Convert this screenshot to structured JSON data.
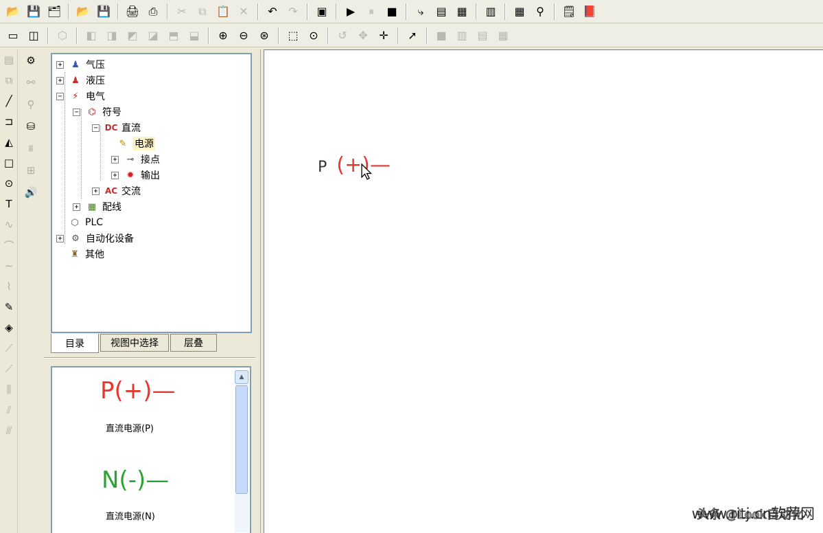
{
  "colors": {
    "positive": "#e8352d",
    "negative": "#2aa532"
  },
  "toolbar1": {
    "items": [
      {
        "icon": "open-folder-icon",
        "glyph": "📂"
      },
      {
        "icon": "save-icon",
        "glyph": "💾"
      },
      {
        "icon": "save-all-icon",
        "glyph": "🗂"
      },
      {
        "sep": true
      },
      {
        "icon": "open-icon",
        "glyph": "📂"
      },
      {
        "icon": "save-disk-icon",
        "glyph": "💾"
      },
      {
        "sep": true
      },
      {
        "icon": "print-preview-icon",
        "glyph": "🖨"
      },
      {
        "icon": "print-icon",
        "glyph": "⎙"
      },
      {
        "sep": true
      },
      {
        "icon": "cut-icon",
        "glyph": "✂",
        "dis": true
      },
      {
        "icon": "copy-icon",
        "glyph": "⧉",
        "dis": true
      },
      {
        "icon": "paste-icon",
        "glyph": "📋",
        "dis": true
      },
      {
        "icon": "delete-icon",
        "glyph": "✕",
        "dis": true
      },
      {
        "sep": true
      },
      {
        "icon": "undo-icon",
        "glyph": "↶"
      },
      {
        "icon": "redo-icon",
        "glyph": "↷",
        "dis": true
      },
      {
        "sep": true
      },
      {
        "icon": "simulate-icon",
        "glyph": "▣"
      },
      {
        "sep": true
      },
      {
        "icon": "play-icon",
        "glyph": "▶"
      },
      {
        "icon": "pause-icon",
        "glyph": "⏸",
        "dis": true
      },
      {
        "icon": "stop-icon",
        "glyph": "■"
      },
      {
        "sep": true
      },
      {
        "icon": "connect-icon",
        "glyph": "⤷"
      },
      {
        "icon": "document-icon",
        "glyph": "▤"
      },
      {
        "icon": "document-check-icon",
        "glyph": "▦"
      },
      {
        "sep": true
      },
      {
        "icon": "library-icon",
        "glyph": "▥"
      },
      {
        "sep": true
      },
      {
        "icon": "grid-icon",
        "glyph": "▦"
      },
      {
        "icon": "probe-icon",
        "glyph": "⚲"
      },
      {
        "sep": true
      },
      {
        "icon": "notes-icon",
        "glyph": "🗒"
      },
      {
        "icon": "help-book-icon",
        "glyph": "📕"
      }
    ]
  },
  "toolbar2": {
    "items": [
      {
        "icon": "layout-single-icon",
        "glyph": "▭"
      },
      {
        "icon": "layout-split-icon",
        "glyph": "◫"
      },
      {
        "sep": true
      },
      {
        "icon": "shape-box-icon",
        "glyph": "⬡",
        "dis": true
      },
      {
        "sep": true
      },
      {
        "icon": "view-front-icon",
        "glyph": "◧",
        "dis": true
      },
      {
        "icon": "view-side-icon",
        "glyph": "◨",
        "dis": true
      },
      {
        "icon": "view-top-icon",
        "glyph": "◩",
        "dis": true
      },
      {
        "icon": "view-iso-icon",
        "glyph": "◪",
        "dis": true
      },
      {
        "icon": "view-back-icon",
        "glyph": "⬒",
        "dis": true
      },
      {
        "icon": "view-bottom-icon",
        "glyph": "⬓",
        "dis": true
      },
      {
        "sep": true
      },
      {
        "icon": "zoom-in-icon",
        "glyph": "⊕"
      },
      {
        "icon": "zoom-out-icon",
        "glyph": "⊖"
      },
      {
        "icon": "zoom-fit-icon",
        "glyph": "⊛"
      },
      {
        "sep": true
      },
      {
        "icon": "zoom-window-icon",
        "glyph": "⬚"
      },
      {
        "icon": "zoom-region-icon",
        "glyph": "⊙"
      },
      {
        "sep": true
      },
      {
        "icon": "rotate-icon",
        "glyph": "↺",
        "dis": true
      },
      {
        "icon": "orbit-icon",
        "glyph": "✥",
        "dis": true
      },
      {
        "icon": "pan-icon",
        "glyph": "✛"
      },
      {
        "sep": true
      },
      {
        "icon": "select-pointer-icon",
        "glyph": "➚"
      },
      {
        "sep": true
      },
      {
        "icon": "panel-full-icon",
        "glyph": "■",
        "dis": true
      },
      {
        "icon": "panel-vertical-icon",
        "glyph": "▥",
        "dis": true
      },
      {
        "icon": "panel-horizontal-icon",
        "glyph": "▤",
        "dis": true
      },
      {
        "icon": "panel-quad-icon",
        "glyph": "▦",
        "dis": true
      }
    ]
  },
  "draw_tools": [
    {
      "icon": "page-icon",
      "glyph": "▤",
      "dis": true
    },
    {
      "icon": "page-link-icon",
      "glyph": "⧉",
      "dis": true
    },
    {
      "icon": "line-tool-icon",
      "glyph": "╱"
    },
    {
      "icon": "polyline-tool-icon",
      "glyph": "⊐"
    },
    {
      "icon": "polygon-tool-icon",
      "glyph": "◭"
    },
    {
      "icon": "rectangle-tool-icon",
      "glyph": "□"
    },
    {
      "icon": "ellipse-tool-icon",
      "glyph": "⊙"
    },
    {
      "icon": "text-tool-icon",
      "glyph": "T"
    },
    {
      "icon": "curve-tool-icon",
      "glyph": "∿",
      "dis": true
    },
    {
      "icon": "arc-tool-icon",
      "glyph": "⌒",
      "dis": true
    },
    {
      "icon": "bezier-tool-icon",
      "glyph": "∼",
      "dis": true
    },
    {
      "icon": "spline-tool-icon",
      "glyph": "⌇",
      "dis": true
    },
    {
      "icon": "pen-tool-icon",
      "glyph": "✎"
    },
    {
      "icon": "fill-tool-icon",
      "glyph": "◈"
    },
    {
      "icon": "graph-tool-icon",
      "glyph": "⟋",
      "dis": true
    },
    {
      "icon": "graph2-tool-icon",
      "glyph": "⟋",
      "dis": true
    },
    {
      "icon": "align-tool-icon",
      "glyph": "⫼",
      "dis": true
    },
    {
      "icon": "distribute-tool-icon",
      "glyph": "⫽",
      "dis": true
    },
    {
      "icon": "group-tool-icon",
      "glyph": "⫻",
      "dis": true
    }
  ],
  "component_tools": [
    {
      "icon": "component-icon",
      "glyph": "⚙"
    },
    {
      "icon": "link-component-icon",
      "glyph": "⚯",
      "dis": true
    },
    {
      "icon": "move-person-icon",
      "glyph": "⚲",
      "dis": true
    },
    {
      "icon": "cylinder-icon",
      "glyph": "⛁"
    },
    {
      "icon": "chart-icon",
      "glyph": "⩩",
      "dis": true
    },
    {
      "icon": "table-icon",
      "glyph": "⊞",
      "dis": true
    },
    {
      "icon": "speaker-icon",
      "glyph": "🔊"
    }
  ],
  "tree": {
    "nodes": [
      {
        "label": "气压",
        "icon": "pneumatic-icon",
        "glyph": "♟",
        "color": "#3557b5",
        "expander": "+"
      },
      {
        "label": "液压",
        "icon": "hydraulic-icon",
        "glyph": "♟",
        "color": "#c4302b",
        "expander": "+"
      },
      {
        "label": "电气",
        "icon": "electrical-icon",
        "glyph": "⚡",
        "color": "#b42020",
        "expander": "−"
      },
      {
        "label": "符号",
        "icon": "symbol-icon",
        "glyph": "⌬",
        "color": "#b42020",
        "expander": "−"
      },
      {
        "label": "直流",
        "icon": "dc-icon",
        "glyph": "DC",
        "color": "#c42c2c",
        "expander": "−"
      },
      {
        "label": "电源",
        "icon": "power-source-icon",
        "glyph": "✎",
        "color": "#b8860b",
        "expander": ""
      },
      {
        "label": "接点",
        "icon": "contact-icon",
        "glyph": "⊸",
        "color": "#333333",
        "expander": "+"
      },
      {
        "label": "输出",
        "icon": "output-icon",
        "glyph": "✹",
        "color": "#d42020",
        "expander": "+"
      },
      {
        "label": "交流",
        "icon": "ac-icon",
        "glyph": "AC",
        "color": "#c42c2c",
        "expander": "+"
      },
      {
        "label": "配线",
        "icon": "wiring-icon",
        "glyph": "▦",
        "color": "#4a7a2a",
        "expander": "+"
      },
      {
        "label": "PLC",
        "icon": "plc-icon",
        "glyph": "⬡",
        "color": "#555555",
        "expander": ""
      },
      {
        "label": "自动化设备",
        "icon": "automation-icon",
        "glyph": "⚙",
        "color": "#555555",
        "expander": "+"
      },
      {
        "label": "其他",
        "icon": "other-icon",
        "glyph": "♜",
        "color": "#8a6a2a",
        "expander": ""
      }
    ]
  },
  "tabs": {
    "catalog": "目录",
    "select_in_view": "视图中选择",
    "layers": "层叠"
  },
  "preview": {
    "positive_symbol": "P(+)—",
    "positive_caption": "直流电源(P)",
    "negative_symbol": "N(-)—",
    "negative_caption": "直流电源(N)"
  },
  "canvas": {
    "label_p": "P",
    "symbol": "(+)—"
  },
  "watermark": {
    "text": "头条 @Look自动化",
    "site": "www.ritj.cn软荐网"
  }
}
